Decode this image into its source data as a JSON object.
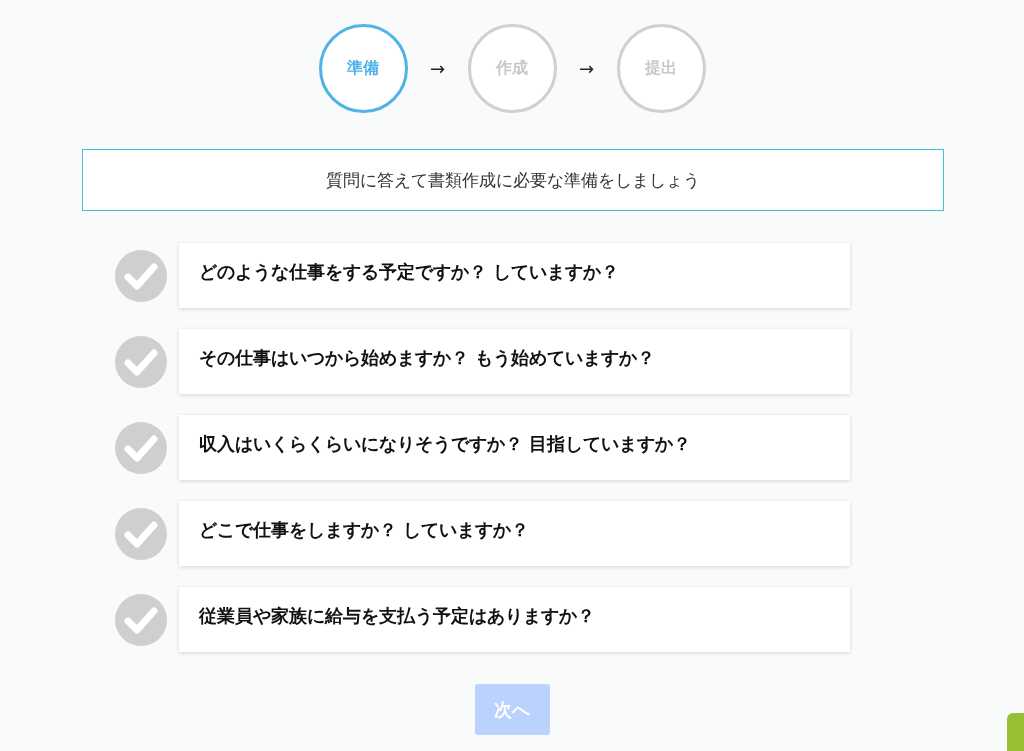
{
  "steps": [
    {
      "label": "準備",
      "selected": true
    },
    {
      "label": "作成",
      "selected": false
    },
    {
      "label": "提出",
      "selected": false
    }
  ],
  "step_arrow": "→",
  "intro": "質問に答えて書類作成に必要な準備をしましょう",
  "questions": [
    {
      "text": "どのような仕事をする予定ですか？ していますか？",
      "answered": false
    },
    {
      "text": "その仕事はいつから始めますか？ もう始めていますか？",
      "answered": false
    },
    {
      "text": "収入はいくらくらいになりそうですか？ 目指していますか？",
      "answered": false
    },
    {
      "text": "どこで仕事をしますか？ していますか？",
      "answered": false
    },
    {
      "text": "従業員や家族に給与を支払う予定はありますか？",
      "answered": false
    }
  ],
  "next_button": {
    "label": "次へ",
    "disabled": true
  }
}
